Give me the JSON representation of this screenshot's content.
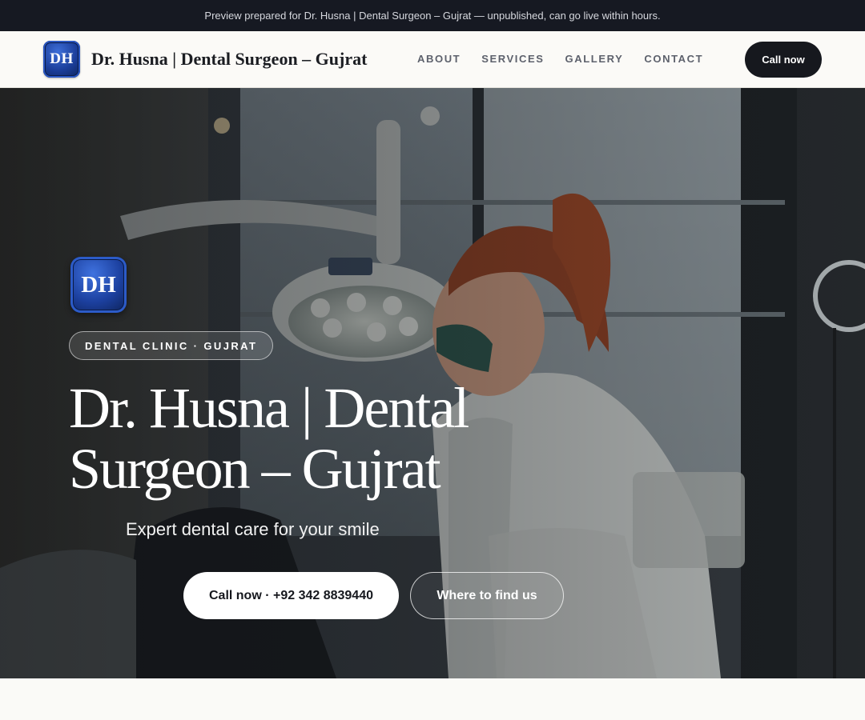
{
  "banner": {
    "text": "Preview prepared for Dr. Husna | Dental Surgeon – Gujrat — unpublished, can go live within hours."
  },
  "header": {
    "logo_initials": "DH",
    "title": "Dr. Husna | Dental Surgeon – Gujrat",
    "nav": [
      {
        "label": "ABOUT"
      },
      {
        "label": "SERVICES"
      },
      {
        "label": "GALLERY"
      },
      {
        "label": "CONTACT"
      }
    ],
    "cta_label": "Call now"
  },
  "hero": {
    "logo_initials": "DH",
    "pill": "DENTAL CLINIC · GUJRAT",
    "title": "Dr. Husna | Dental Surgeon – Gujrat",
    "subtitle": "Expert dental care for your smile",
    "primary_button": "Call now · +92 342 8839440",
    "secondary_button": "Where to find us",
    "background_image": "dentist-treating-patient-photo"
  },
  "colors": {
    "banner_bg": "#161922",
    "header_bg": "#fbfaf7",
    "accent_dark": "#16181e",
    "logo_blue": "#1b3e9a",
    "nav_text": "#5d616c"
  }
}
